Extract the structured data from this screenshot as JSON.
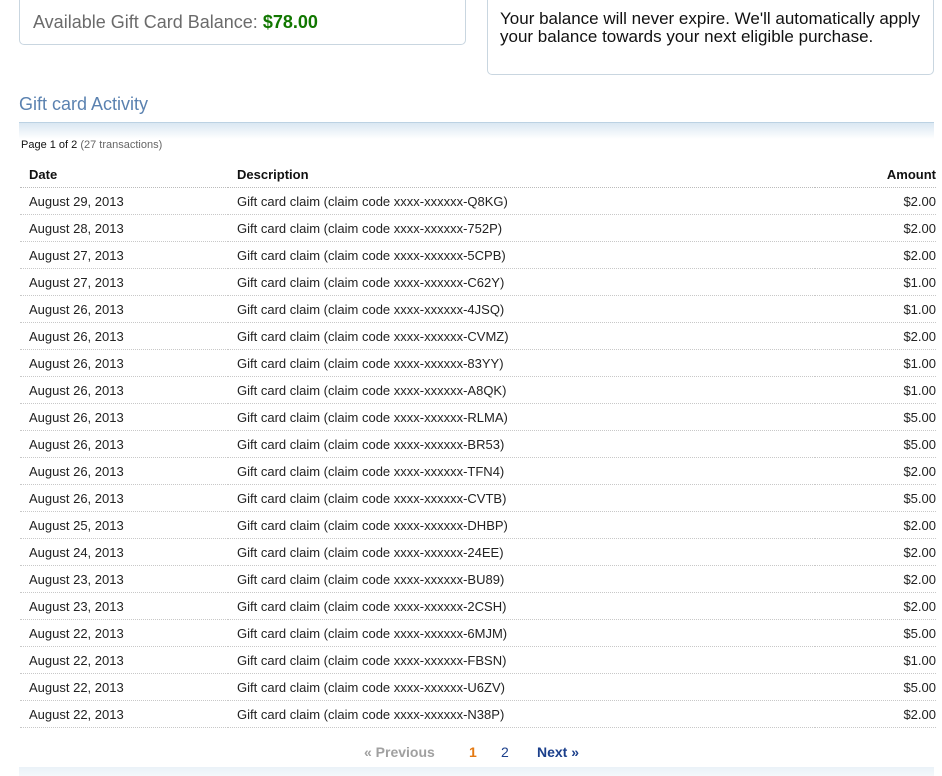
{
  "balance": {
    "label": "Available Gift Card Balance:",
    "amount": "$78.00"
  },
  "notice": {
    "text": "Your balance will never expire. We'll automatically apply your balance towards your next eligible purchase."
  },
  "activity": {
    "title": "Gift card Activity",
    "page_info": "Page 1 of 2",
    "transactions_count": "(27 transactions)",
    "columns": {
      "date": "Date",
      "description": "Description",
      "amount": "Amount"
    },
    "rows": [
      {
        "date": "August 29, 2013",
        "description": "Gift card claim (claim code xxxx-xxxxxx-Q8KG)",
        "amount": "$2.00"
      },
      {
        "date": "August 28, 2013",
        "description": "Gift card claim (claim code xxxx-xxxxxx-752P)",
        "amount": "$2.00"
      },
      {
        "date": "August 27, 2013",
        "description": "Gift card claim (claim code xxxx-xxxxxx-5CPB)",
        "amount": "$2.00"
      },
      {
        "date": "August 27, 2013",
        "description": "Gift card claim (claim code xxxx-xxxxxx-C62Y)",
        "amount": "$1.00"
      },
      {
        "date": "August 26, 2013",
        "description": "Gift card claim (claim code xxxx-xxxxxx-4JSQ)",
        "amount": "$1.00"
      },
      {
        "date": "August 26, 2013",
        "description": "Gift card claim (claim code xxxx-xxxxxx-CVMZ)",
        "amount": "$2.00"
      },
      {
        "date": "August 26, 2013",
        "description": "Gift card claim (claim code xxxx-xxxxxx-83YY)",
        "amount": "$1.00"
      },
      {
        "date": "August 26, 2013",
        "description": "Gift card claim (claim code xxxx-xxxxxx-A8QK)",
        "amount": "$1.00"
      },
      {
        "date": "August 26, 2013",
        "description": "Gift card claim (claim code xxxx-xxxxxx-RLMA)",
        "amount": "$5.00"
      },
      {
        "date": "August 26, 2013",
        "description": "Gift card claim (claim code xxxx-xxxxxx-BR53)",
        "amount": "$5.00"
      },
      {
        "date": "August 26, 2013",
        "description": "Gift card claim (claim code xxxx-xxxxxx-TFN4)",
        "amount": "$2.00"
      },
      {
        "date": "August 26, 2013",
        "description": "Gift card claim (claim code xxxx-xxxxxx-CVTB)",
        "amount": "$5.00"
      },
      {
        "date": "August 25, 2013",
        "description": "Gift card claim (claim code xxxx-xxxxxx-DHBP)",
        "amount": "$2.00"
      },
      {
        "date": "August 24, 2013",
        "description": "Gift card claim (claim code xxxx-xxxxxx-24EE)",
        "amount": "$2.00"
      },
      {
        "date": "August 23, 2013",
        "description": "Gift card claim (claim code xxxx-xxxxxx-BU89)",
        "amount": "$2.00"
      },
      {
        "date": "August 23, 2013",
        "description": "Gift card claim (claim code xxxx-xxxxxx-2CSH)",
        "amount": "$2.00"
      },
      {
        "date": "August 22, 2013",
        "description": "Gift card claim (claim code xxxx-xxxxxx-6MJM)",
        "amount": "$5.00"
      },
      {
        "date": "August 22, 2013",
        "description": "Gift card claim (claim code xxxx-xxxxxx-FBSN)",
        "amount": "$1.00"
      },
      {
        "date": "August 22, 2013",
        "description": "Gift card claim (claim code xxxx-xxxxxx-U6ZV)",
        "amount": "$5.00"
      },
      {
        "date": "August 22, 2013",
        "description": "Gift card claim (claim code xxxx-xxxxxx-N38P)",
        "amount": "$2.00"
      }
    ]
  },
  "pagination": {
    "previous": "« Previous",
    "pages": [
      "1",
      "2"
    ],
    "current": "1",
    "next": "Next »"
  },
  "colors": {
    "balance_amount": "#117700",
    "title": "#5b82b0",
    "current_page": "#e47911",
    "link": "#1b3f8b"
  }
}
